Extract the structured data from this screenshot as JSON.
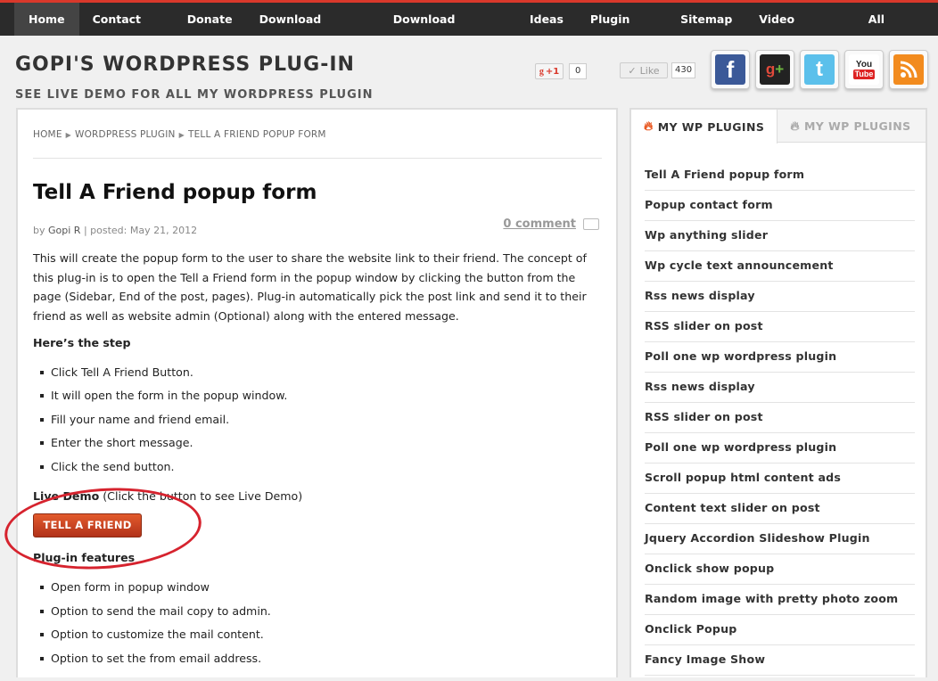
{
  "nav": {
    "items": [
      {
        "label": "Home"
      },
      {
        "label": "Contact Me"
      },
      {
        "label": "Donate"
      },
      {
        "label": "Download plugins"
      },
      {
        "label": "Download Themes"
      },
      {
        "label": "Ideas"
      },
      {
        "label": "Plugin List"
      },
      {
        "label": "Sitemap"
      },
      {
        "label": "Video tutorial"
      },
      {
        "label": "All Topics"
      }
    ],
    "active": "Home"
  },
  "header": {
    "title": "GOPI'S WORDPRESS PLUG-IN",
    "tagline": "SEE LIVE DEMO FOR ALL MY WORDPRESS PLUGIN"
  },
  "share": {
    "gplus_label": "+1",
    "gplus_count": "0",
    "like_label": "Like",
    "like_count": "430",
    "social_icons": [
      "facebook-icon",
      "google-plus-icon",
      "twitter-icon",
      "youtube-icon",
      "rss-icon"
    ],
    "youtube_text_1": "You",
    "youtube_text_2": "Tube"
  },
  "breadcrumb": {
    "items": [
      "HOME",
      "WORDPRESS PLUGIN",
      "TELL A FRIEND POPUP FORM"
    ]
  },
  "post": {
    "title": "Tell A Friend popup form",
    "by": "by",
    "author": "Gopi R",
    "posted": "| posted: May 21, 2012",
    "comments": "0 comment",
    "intro": "This will create the popup form to the user to share the website link to their friend. The concept of this plug-in is to open the Tell a Friend form in the popup window by clicking the button from the page (Sidebar, End of the post, pages). Plug-in automatically pick the post link and send it to their friend as well as website admin (Optional) along with the entered message.",
    "steps_heading": "Here’s the step",
    "steps": [
      "Click Tell A Friend Button.",
      "It will open the form in the popup window.",
      "Fill your name and friend email.",
      "Enter the short message.",
      "Click the send button."
    ],
    "live_demo_bold": "Live Demo",
    "live_demo_rest": " (Click the button to see Live Demo)",
    "demo_button": "TELL A FRIEND",
    "features_heading": "Plug-in features",
    "features": [
      "Open form in popup window",
      "Option to send the mail copy to admin.",
      "Option to customize the mail content.",
      "Option to set the from email address."
    ]
  },
  "sidebar": {
    "tabs": [
      {
        "label": "MY WP PLUGINS",
        "active": true
      },
      {
        "label": "MY WP PLUGINS",
        "active": false
      }
    ],
    "plugins": [
      "Tell A Friend popup form",
      "Popup contact form",
      "Wp anything slider",
      "Wp cycle text announcement",
      "Rss news display",
      "RSS slider on post",
      "Poll one wp wordpress plugin",
      "Rss news display",
      "RSS slider on post",
      "Poll one wp wordpress plugin",
      "Scroll popup html content ads",
      "Content text slider on post",
      "Jquery Accordion Slideshow Plugin",
      "Onclick show popup",
      "Random image with pretty photo zoom",
      "Onclick Popup",
      "Fancy Image Show"
    ]
  },
  "colors": {
    "accent": "#d9382b",
    "nav_bg": "#2b2b2b",
    "button_red": "#c8401f",
    "annotation_circle": "#d6232e"
  }
}
